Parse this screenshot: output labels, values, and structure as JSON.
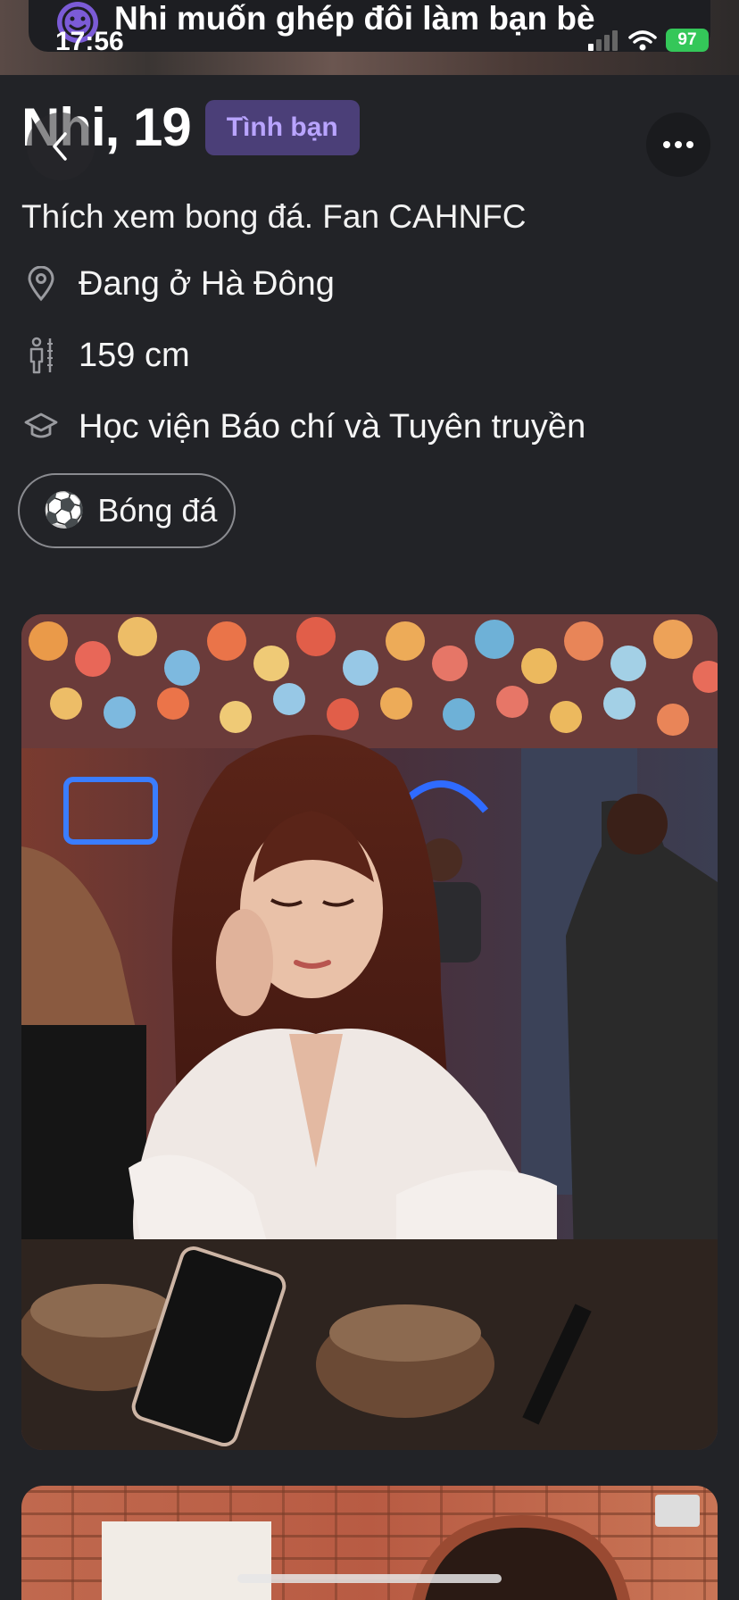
{
  "status_bar": {
    "time": "17:56",
    "battery": "97"
  },
  "banner": {
    "text": "Nhi muốn ghép đôi làm bạn bè",
    "icon": "smiley-icon"
  },
  "profile": {
    "name_age": "Nhi, 19",
    "badge": "Tình bạn",
    "bio": "Thích xem bong đá. Fan CAHNFC",
    "location": "Đang ở Hà Đông",
    "height": "159 cm",
    "school": "Học viện Báo chí và Tuyên truyền",
    "interests": [
      {
        "emoji": "⚽",
        "label": "Bóng đá"
      }
    ]
  },
  "colors": {
    "background": "#222327",
    "badge_bg": "#4b3f78",
    "badge_text": "#b9a4ff",
    "banner_icon": "#7b5bd6",
    "battery": "#34c759"
  }
}
